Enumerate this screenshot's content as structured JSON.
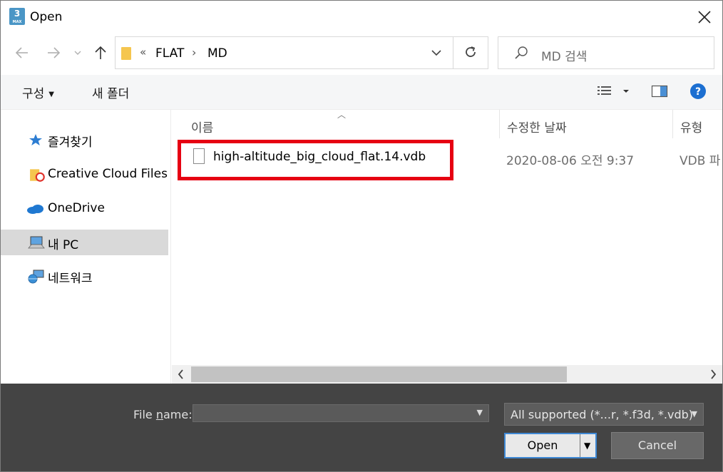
{
  "window": {
    "title": "Open",
    "app_icon_text": "3",
    "app_icon_sub": "MAX"
  },
  "address": {
    "overflow": "«",
    "crumbs": [
      "FLAT",
      "MD"
    ],
    "separator": "›"
  },
  "search": {
    "placeholder": "MD 검색"
  },
  "toolbar": {
    "organize_label": "구성",
    "new_folder_label": "새 폴더"
  },
  "nav_pane": {
    "items": [
      {
        "label": "즐겨찾기",
        "icon": "star-icon"
      },
      {
        "label": "Creative Cloud Files",
        "icon": "creative-cloud-folder-icon"
      },
      {
        "label": "OneDrive",
        "icon": "onedrive-cloud-icon"
      },
      {
        "label": "내 PC",
        "icon": "computer-icon",
        "selected": true
      },
      {
        "label": "네트워크",
        "icon": "network-icon"
      }
    ]
  },
  "file_list": {
    "columns": {
      "name": "이름",
      "date": "수정한 날짜",
      "type": "유형"
    },
    "rows": [
      {
        "name": "high-altitude_big_cloud_flat.14.vdb",
        "date": "2020-08-06 오전 9:37",
        "type": "VDB 파"
      }
    ]
  },
  "bottom": {
    "file_name_label_prefix": "File ",
    "file_name_label_underlined": "n",
    "file_name_label_suffix": "ame:",
    "file_name_value": "",
    "filter_value": "All supported (*...r, *.f3d, *.vdb)",
    "open_label": "Open",
    "cancel_label": "Cancel"
  },
  "colors": {
    "highlight_border": "#e60012",
    "open_button_border": "#3e88d4",
    "bottom_panel": "#444444",
    "help_blue": "#1c6fd1",
    "folder_yellow": "#f5c64f"
  }
}
